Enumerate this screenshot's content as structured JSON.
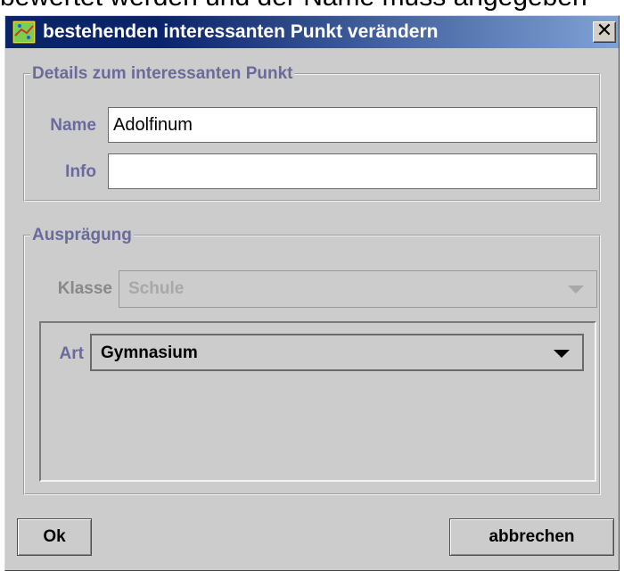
{
  "background_text": "bewertet werden und der Name muss angegeben",
  "window": {
    "title": "bestehenden interessanten Punkt verändern",
    "close_glyph": "✕"
  },
  "details": {
    "legend": "Details zum interessanten Punkt",
    "name_label": "Name",
    "name_value": "Adolfinum",
    "info_label": "Info",
    "info_value": ""
  },
  "auspraegung": {
    "legend": "Ausprägung",
    "klasse_label": "Klasse",
    "klasse_value": "Schule",
    "art_label": "Art",
    "art_value": "Gymnasium"
  },
  "buttons": {
    "ok": "Ok",
    "cancel": "abbrechen"
  },
  "icons": {
    "app": "map-icon",
    "close": "close-icon",
    "dropdown": "triangle-down-icon"
  },
  "colors": {
    "label": "#6a6a9c",
    "title_bg": "#0a246a",
    "window_bg": "#cccccc"
  }
}
